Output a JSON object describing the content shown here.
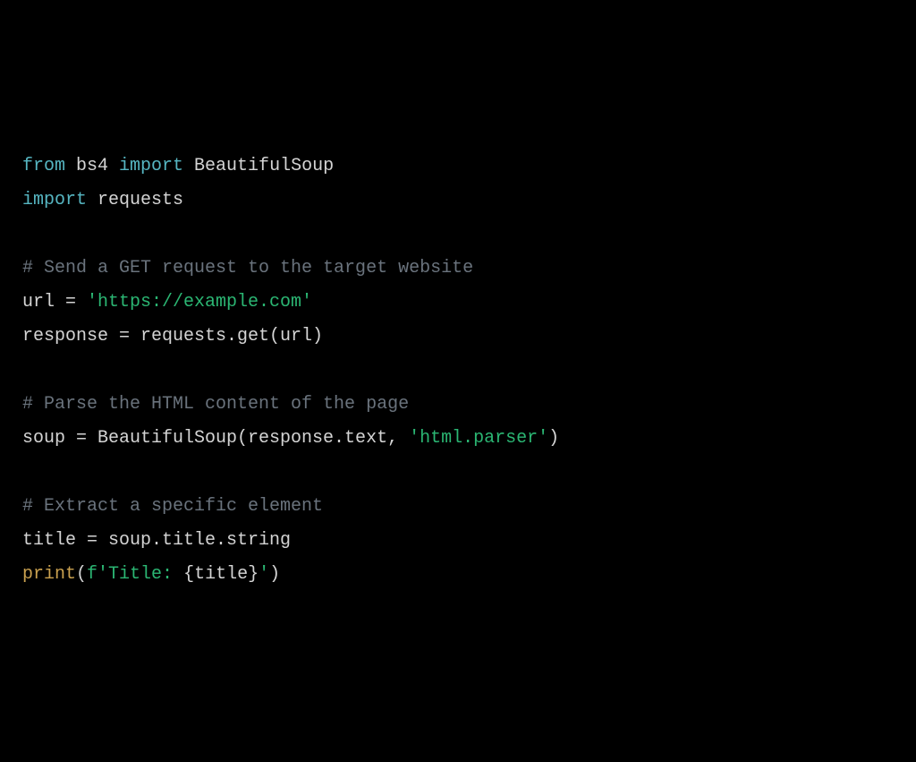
{
  "code": {
    "tokens": [
      {
        "text": "from",
        "cls": "keyword"
      },
      {
        "text": " bs4 ",
        "cls": "ident"
      },
      {
        "text": "import",
        "cls": "keyword"
      },
      {
        "text": " BeautifulSoup",
        "cls": "ident"
      },
      {
        "text": "\n",
        "cls": ""
      },
      {
        "text": "import",
        "cls": "keyword"
      },
      {
        "text": " requests",
        "cls": "ident"
      },
      {
        "text": "\n",
        "cls": ""
      },
      {
        "text": "\n",
        "cls": ""
      },
      {
        "text": "# Send a GET request to the target website",
        "cls": "comment"
      },
      {
        "text": "\n",
        "cls": ""
      },
      {
        "text": "url = ",
        "cls": "ident"
      },
      {
        "text": "'https://example.com'",
        "cls": "string"
      },
      {
        "text": "\n",
        "cls": ""
      },
      {
        "text": "response = requests.get(url)",
        "cls": "ident"
      },
      {
        "text": "\n",
        "cls": ""
      },
      {
        "text": "\n",
        "cls": ""
      },
      {
        "text": "# Parse the HTML content of the page",
        "cls": "comment"
      },
      {
        "text": "\n",
        "cls": ""
      },
      {
        "text": "soup = BeautifulSoup(response.text, ",
        "cls": "ident"
      },
      {
        "text": "'html.parser'",
        "cls": "string"
      },
      {
        "text": ")",
        "cls": "ident"
      },
      {
        "text": "\n",
        "cls": ""
      },
      {
        "text": "\n",
        "cls": ""
      },
      {
        "text": "# Extract a specific element",
        "cls": "comment"
      },
      {
        "text": "\n",
        "cls": ""
      },
      {
        "text": "title = soup.title.string",
        "cls": "ident"
      },
      {
        "text": "\n",
        "cls": ""
      },
      {
        "text": "print",
        "cls": "func"
      },
      {
        "text": "(",
        "cls": "ident"
      },
      {
        "text": "f'Title: ",
        "cls": "string"
      },
      {
        "text": "{title}",
        "cls": "ident"
      },
      {
        "text": "'",
        "cls": "string"
      },
      {
        "text": ")",
        "cls": "ident"
      }
    ]
  }
}
